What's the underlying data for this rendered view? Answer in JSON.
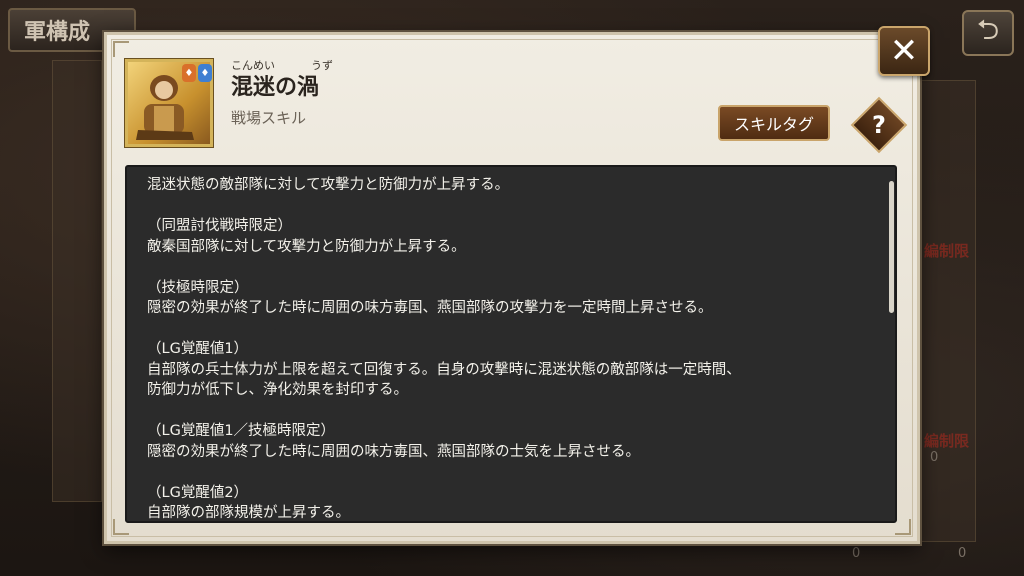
{
  "background": {
    "header_title": "軍構成",
    "back_icon": "return-arrow-icon",
    "limit_tag_1": "編制限",
    "limit_tag_2": "編制限",
    "stat_value_1": "0",
    "stat_value_2": "0",
    "stat_value_3": "0"
  },
  "dialog": {
    "close_icon": "close-x-icon",
    "skill": {
      "furigana_1": "こんめい",
      "furigana_2": "うず",
      "name": "混迷の渦",
      "type": "戦場スキル",
      "icon": "warrior-portrait-icon"
    },
    "tag_button_label": "スキルタグ",
    "help_button_label": "?",
    "description": "混迷状態の敵部隊に対して攻撃力と防御力が上昇する。\n\n（同盟討伐戦時限定）\n敵秦国部隊に対して攻撃力と防御力が上昇する。\n\n（技極時限定）\n隠密の効果が終了した時に周囲の味方毐国、燕国部隊の攻撃力を一定時間上昇させる。\n\n（LG覚醒値1）\n自部隊の兵士体力が上限を超えて回復する。自身の攻撃時に混迷状態の敵部隊は一定時間、\n防御力が低下し、浄化効果を封印する。\n\n（LG覚醒値1／技極時限定）\n隠密の効果が終了した時に周囲の味方毐国、燕国部隊の士気を上昇させる。\n\n（LG覚醒値2）\n自部隊の部隊規模が上昇する。"
  },
  "colors": {
    "accent_gold": "#d4b45a",
    "button_brown": "#5e3518",
    "panel_dark": "#2b2b2b",
    "parchment": "#ece6d9"
  }
}
